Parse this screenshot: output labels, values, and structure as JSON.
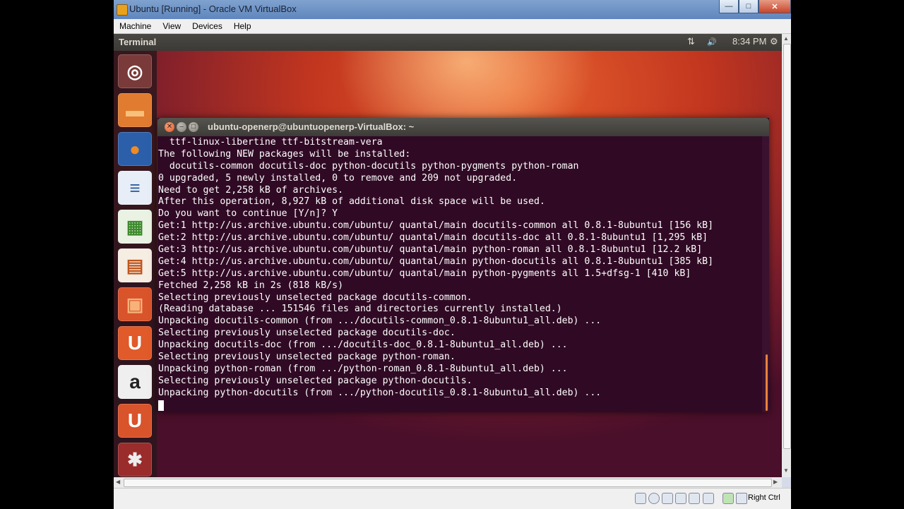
{
  "vbox": {
    "title": "Ubuntu [Running] - Oracle VM VirtualBox",
    "window_buttons": {
      "minimize": "—",
      "maximize": "□",
      "close": "✕"
    },
    "menu": [
      "Machine",
      "View",
      "Devices",
      "Help"
    ],
    "host_key": "Right Ctrl"
  },
  "panel": {
    "app_title": "Terminal",
    "network_glyph": "⇅",
    "volume_glyph": "🔊",
    "time": "8:34 PM",
    "gear_glyph": "⚙"
  },
  "launcher": {
    "items": [
      {
        "name": "dash-home",
        "glyph": "◎",
        "bg": "#7a3a3a",
        "fg": "#ffffff"
      },
      {
        "name": "files",
        "glyph": "▬",
        "bg": "#e07b2f",
        "fg": "#f6c07a"
      },
      {
        "name": "firefox",
        "glyph": "●",
        "bg": "#2b5fa9",
        "fg": "#f08a24"
      },
      {
        "name": "writer",
        "glyph": "≡",
        "bg": "#e8eef7",
        "fg": "#2f5f9e"
      },
      {
        "name": "calc",
        "glyph": "▦",
        "bg": "#e9f2e3",
        "fg": "#3e8a2e"
      },
      {
        "name": "impress",
        "glyph": "▤",
        "bg": "#f6ede3",
        "fg": "#c0561d"
      },
      {
        "name": "software-center",
        "glyph": "▣",
        "bg": "#d9532b",
        "fg": "#f7b27a"
      },
      {
        "name": "ubuntu-one",
        "glyph": "U",
        "bg": "#e05a2a",
        "fg": "#ffffff"
      },
      {
        "name": "amazon",
        "glyph": "a",
        "bg": "#efefef",
        "fg": "#222222"
      },
      {
        "name": "ubuntu-one-music",
        "glyph": "U",
        "bg": "#d9532b",
        "fg": "#ffffff"
      },
      {
        "name": "system-settings",
        "glyph": "✱",
        "bg": "#9a2c2c",
        "fg": "#eeeeee"
      }
    ]
  },
  "terminal": {
    "title": "ubuntu-openerp@ubuntuopenerp-VirtualBox: ~",
    "lines": [
      "  ttf-linux-libertine ttf-bitstream-vera",
      "The following NEW packages will be installed:",
      "  docutils-common docutils-doc python-docutils python-pygments python-roman",
      "0 upgraded, 5 newly installed, 0 to remove and 209 not upgraded.",
      "Need to get 2,258 kB of archives.",
      "After this operation, 8,927 kB of additional disk space will be used.",
      "Do you want to continue [Y/n]? Y",
      "Get:1 http://us.archive.ubuntu.com/ubuntu/ quantal/main docutils-common all 0.8.1-8ubuntu1 [156 kB]",
      "Get:2 http://us.archive.ubuntu.com/ubuntu/ quantal/main docutils-doc all 0.8.1-8ubuntu1 [1,295 kB]",
      "Get:3 http://us.archive.ubuntu.com/ubuntu/ quantal/main python-roman all 0.8.1-8ubuntu1 [12.2 kB]",
      "Get:4 http://us.archive.ubuntu.com/ubuntu/ quantal/main python-docutils all 0.8.1-8ubuntu1 [385 kB]",
      "Get:5 http://us.archive.ubuntu.com/ubuntu/ quantal/main python-pygments all 1.5+dfsg-1 [410 kB]",
      "Fetched 2,258 kB in 2s (818 kB/s)",
      "Selecting previously unselected package docutils-common.",
      "(Reading database ... 151546 files and directories currently installed.)",
      "Unpacking docutils-common (from .../docutils-common_0.8.1-8ubuntu1_all.deb) ...",
      "Selecting previously unselected package docutils-doc.",
      "Unpacking docutils-doc (from .../docutils-doc_0.8.1-8ubuntu1_all.deb) ...",
      "Selecting previously unselected package python-roman.",
      "Unpacking python-roman (from .../python-roman_0.8.1-8ubuntu1_all.deb) ...",
      "Selecting previously unselected package python-docutils.",
      "Unpacking python-docutils (from .../python-docutils_0.8.1-8ubuntu1_all.deb) ..."
    ]
  }
}
